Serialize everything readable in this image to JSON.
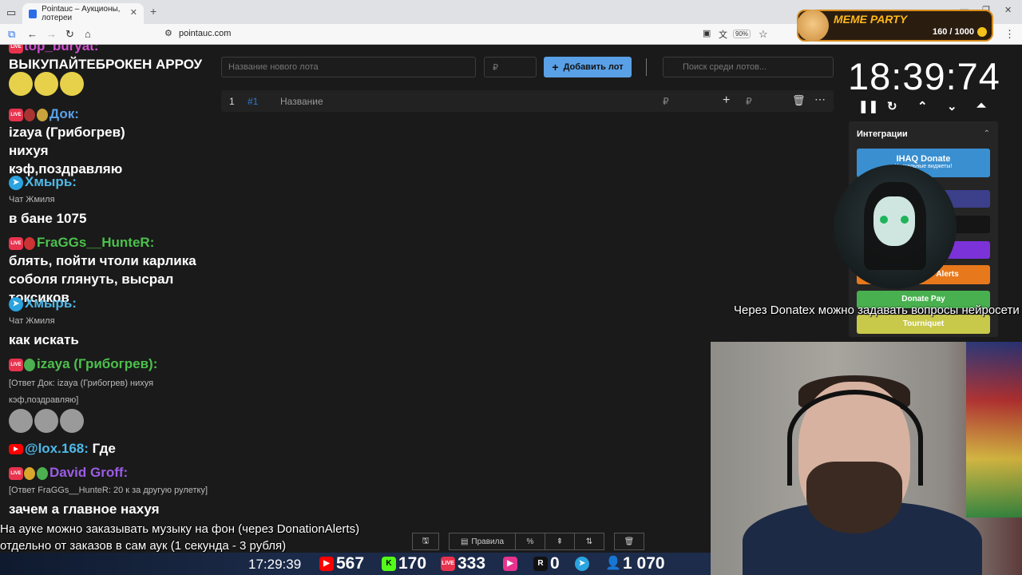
{
  "browser": {
    "tab_title": "Pointauc – Аукционы, лотереи",
    "url": "pointauc.com",
    "zoom": "90%"
  },
  "meme_party": {
    "title": "MEME PARTY",
    "score": "160 / 1000"
  },
  "chat": {
    "messages": [
      {
        "user": "top_buryat:",
        "text": "ВЫКУПАЙТЕБРОКЕН АРРОУ"
      },
      {
        "user": "Док:",
        "text": "izaya (Грибогрев) нихуя кэф,поздравляю"
      },
      {
        "user": "Хмырь:",
        "source": "Чат Жмиля",
        "text": "в бане 1075"
      },
      {
        "user": "FraGGs__HunteR:",
        "text": "блять, пойти чтоли карлика соболя глянуть, высрал токсиков"
      },
      {
        "user": "Хмырь:",
        "source": "Чат Жмиля",
        "text": "как искать"
      },
      {
        "user": "izaya (Грибогрев):",
        "reply": "[Ответ Док: izaya (Грибогрев) нихуя кэф,поздравляю]"
      },
      {
        "user": "@lox.168:",
        "text": "Где"
      },
      {
        "user": "David Groff:",
        "reply": "[Ответ FraGGs__HunteR: 20 к за другую рулетку]",
        "text": "зачем а главное нахуя"
      }
    ]
  },
  "app": {
    "lot_placeholder": "Название нового лота",
    "price_placeholder": "₽",
    "add_button": "Добавить лот",
    "search_placeholder": "Поиск среди лотов...",
    "lot": {
      "index": "1",
      "id": "#1",
      "name": "Название",
      "currency": "₽",
      "plus": "+",
      "currency2": "₽"
    },
    "timer": "18:39:74",
    "toolbar": {
      "rules": "Правила",
      "percent": "%"
    }
  },
  "integrations": {
    "title": "Интеграции",
    "buttons": [
      {
        "label": "IHAQ Donate",
        "sub": "Уникальные виджеты!",
        "color": "#3a8fd0"
      },
      {
        "label": "Donate Pay",
        "color": "#48b04f"
      },
      {
        "label": "Tourniquet",
        "color": "#c8c84a"
      },
      {
        "label": "Alerts",
        "color": "#e8781c"
      }
    ]
  },
  "overlays": {
    "donatex": "Через Donatex можно задавать вопросы нейросети",
    "music_line1": "На ауке можно заказывать музыку на фон (через DonationAlerts)",
    "music_line2": "отдельно от заказов в сам аук (1 секунда - 3 рубля)"
  },
  "stats": {
    "time": "17:29:39",
    "youtube": "567",
    "kick": "170",
    "vk": "333",
    "rutube_label": "R",
    "rutube": "0",
    "viewers": "1 070"
  }
}
